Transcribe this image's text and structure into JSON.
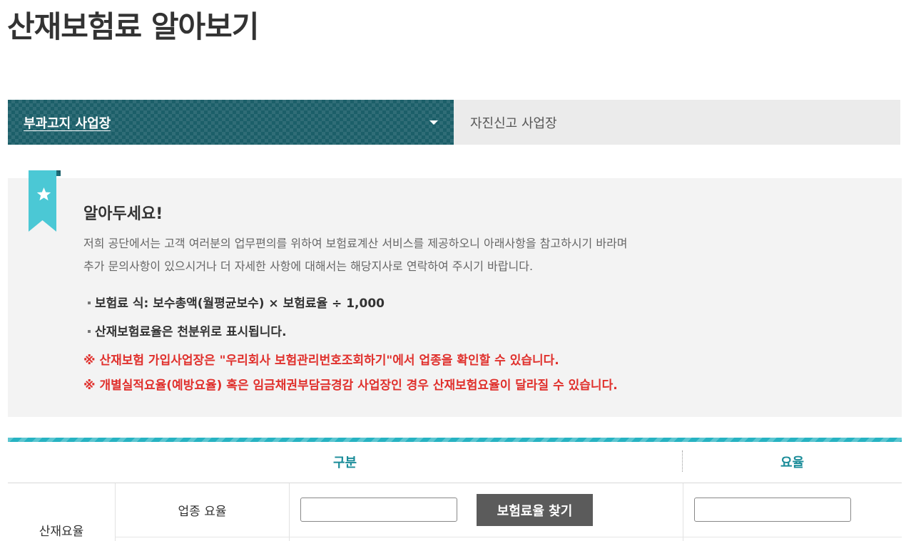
{
  "page": {
    "title": "산재보험료 알아보기"
  },
  "tabs": {
    "active_label": "부과고지 사업장",
    "inactive_label": "자진신고 사업장"
  },
  "notice": {
    "title": "알아두세요!",
    "desc_line1": "저희 공단에서는 고객 여러분의 업무편의를 위하여 보험료계산 서비스를 제공하오니 아래사항을 참고하시기 바라며",
    "desc_line2": "추가 문의사항이 있으시거나 더 자세한 사항에 대해서는 해당지사로 연락하여 주시기 바랍니다.",
    "bullet1": "보험료 식: 보수총액(월평균보수) × 보험료율 ÷ 1,000",
    "bullet2": "산재보험료율은 천분위로 표시됩니다.",
    "warn1": "※ 산재보험 가입사업장은 \"우리회사 보험관리번호조회하기\"에서 업종을 확인할 수 있습니다.",
    "warn2": "※ 개별실적요율(예방요율) 혹은 임금채권부담금경감 사업장인 경우 산재보험요율이 달라질 수 있습니다."
  },
  "table": {
    "header_category": "구분",
    "header_rate": "요율",
    "row_group_label": "산재요율",
    "row1_label": "업종 요율",
    "row1_input_value": "",
    "find_button_label": "보험료율 찾기",
    "row1_rate_value": ""
  },
  "colors": {
    "accent": "#1c5f69",
    "teal": "#27b3c2",
    "header_text": "#1a8c99",
    "warning": "#e0302c",
    "button": "#5b5b5b"
  }
}
